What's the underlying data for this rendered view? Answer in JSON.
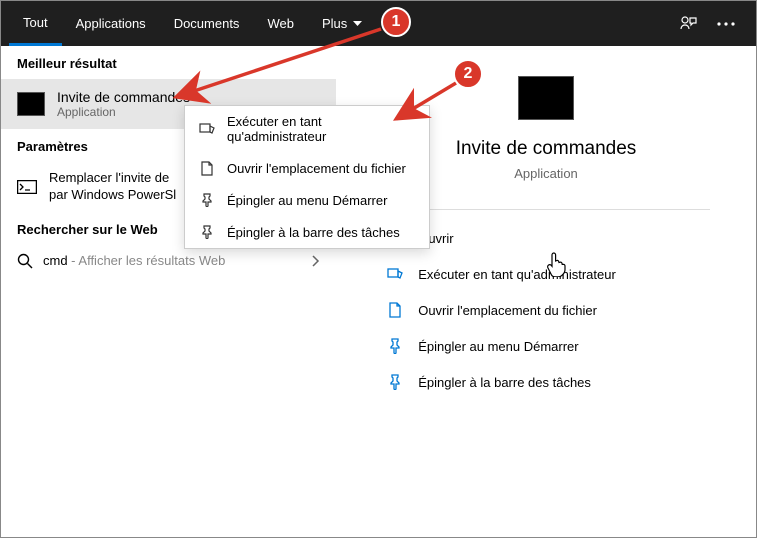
{
  "header": {
    "tabs": {
      "all": "Tout",
      "apps": "Applications",
      "docs": "Documents",
      "web": "Web",
      "more": "Plus"
    }
  },
  "left": {
    "best_header": "Meilleur résultat",
    "best_title": "Invite de commandes",
    "best_sub": "Application",
    "params_header": "Paramètres",
    "param1_line1": "Remplacer l'invite de",
    "param1_line2": "par Windows PowerSl",
    "web_header": "Rechercher sur le Web",
    "web_query": "cmd",
    "web_suffix": " - Afficher les résultats Web"
  },
  "context": {
    "run_admin": "Exécuter en tant qu'administrateur",
    "open_loc": "Ouvrir l'emplacement du fichier",
    "pin_start": "Épingler au menu Démarrer",
    "pin_task": "Épingler à la barre des tâches"
  },
  "right": {
    "title": "Invite de commandes",
    "sub": "Application",
    "open": "Ouvrir",
    "run_admin": "Exécuter en tant qu'administrateur",
    "open_loc": "Ouvrir l'emplacement du fichier",
    "pin_start": "Épingler au menu Démarrer",
    "pin_task": "Épingler à la barre des tâches"
  },
  "annotations": {
    "step1": "1",
    "step2": "2"
  }
}
